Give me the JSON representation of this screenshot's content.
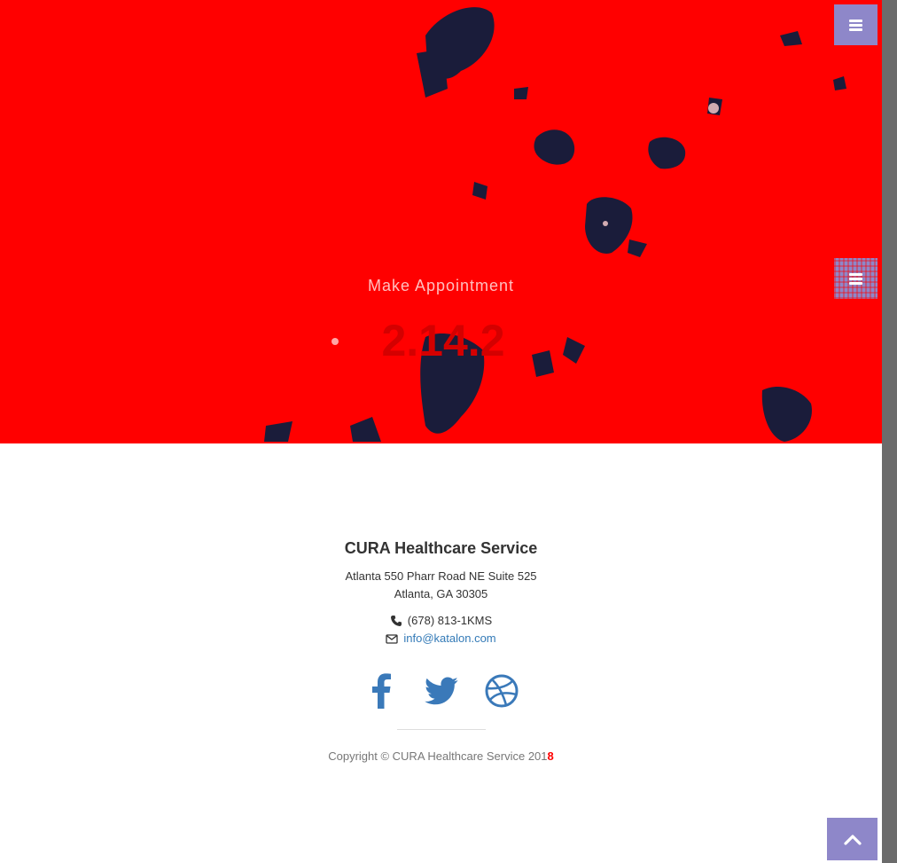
{
  "hero": {
    "subtitle": "Make Appointment",
    "version": "2.14.2"
  },
  "menu": {
    "toggle_icon": "bars-icon"
  },
  "footer": {
    "company": "CURA Healthcare Service",
    "address_line1": "Atlanta 550 Pharr Road NE Suite 525",
    "address_line2": "Atlanta, GA 30305",
    "phone": "(678) 813-1KMS",
    "email": "info@katalon.com",
    "social": [
      {
        "icon": "facebook-icon"
      },
      {
        "icon": "twitter-icon"
      },
      {
        "icon": "dribbble-icon"
      }
    ],
    "copyright_prefix": "Copyright © CURA Healthcare Service 201",
    "copyright_flag": "8"
  },
  "colors": {
    "hero_bg": "#ff0000",
    "accent": "#8e87c9",
    "link": "#337ab7",
    "social": "#3a79b9"
  }
}
